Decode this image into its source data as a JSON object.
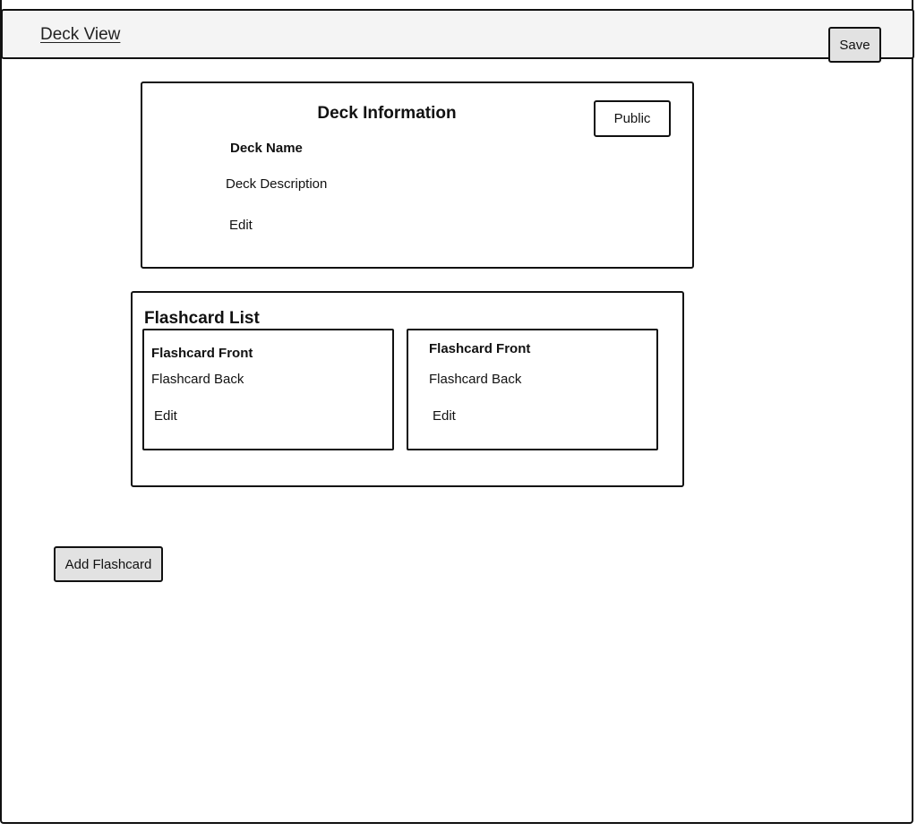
{
  "header": {
    "title": "Deck View",
    "save_label": "Save"
  },
  "deck_info": {
    "heading": "Deck Information",
    "visibility_label": "Public",
    "name": "Deck Name",
    "description": "Deck Description",
    "edit_label": "Edit"
  },
  "flashcard_list": {
    "heading": "Flashcard List",
    "cards": [
      {
        "front": "Flashcard Front",
        "back": "Flashcard Back",
        "edit_label": "Edit"
      },
      {
        "front": "Flashcard Front",
        "back": "Flashcard Back",
        "edit_label": "Edit"
      }
    ]
  },
  "actions": {
    "add_label": "Add Flashcard"
  }
}
